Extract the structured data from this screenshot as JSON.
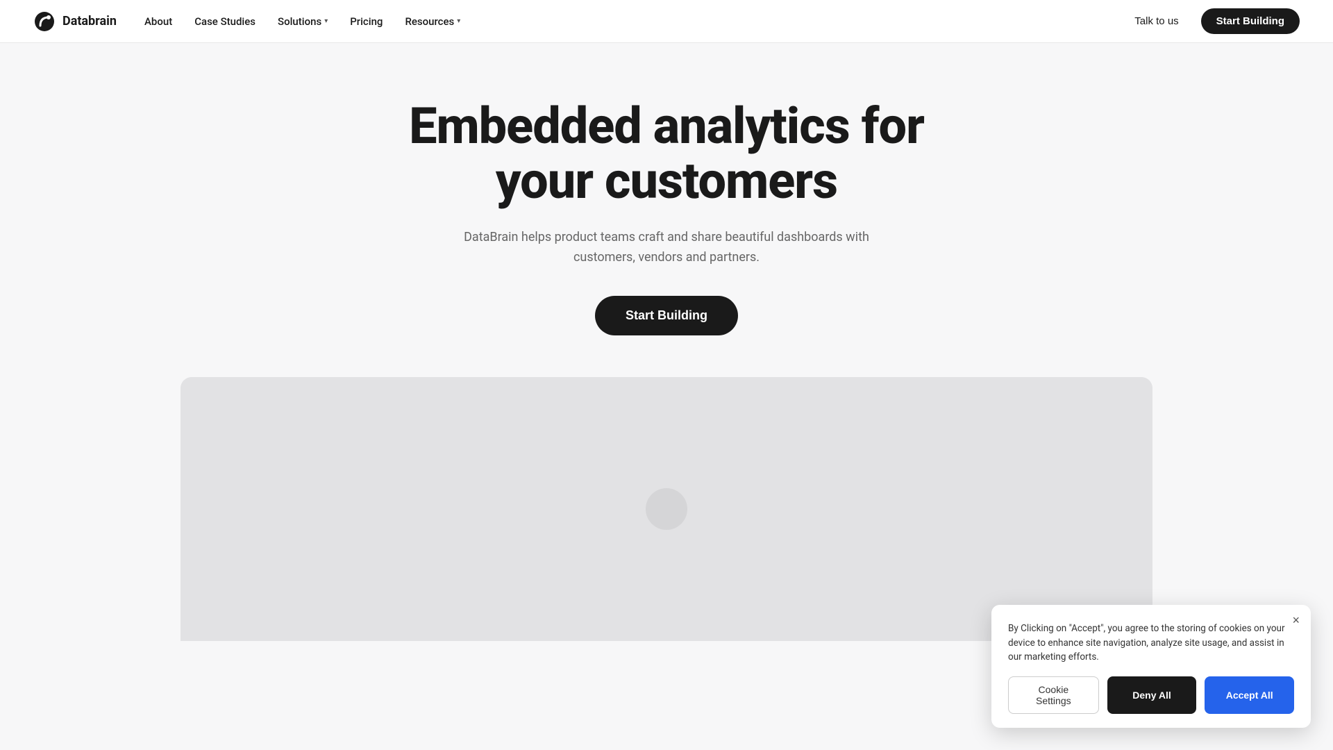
{
  "brand": {
    "name": "Databrain",
    "logo_icon": "databrain-logo-icon"
  },
  "nav": {
    "links": [
      {
        "label": "About",
        "has_dropdown": false
      },
      {
        "label": "Case Studies",
        "has_dropdown": false
      },
      {
        "label": "Solutions",
        "has_dropdown": true
      },
      {
        "label": "Pricing",
        "has_dropdown": false
      },
      {
        "label": "Resources",
        "has_dropdown": true
      }
    ],
    "talk_label": "Talk to us",
    "start_building_label": "Start Building"
  },
  "hero": {
    "title_line1": "Embedded analytics for",
    "title_line2": "your customers",
    "subtitle": "DataBrain helps product teams craft and share beautiful dashboards with customers, vendors and partners.",
    "cta_label": "Start Building"
  },
  "cookie": {
    "text": "By Clicking on \"Accept\", you agree to the storing of cookies on your device to enhance site navigation, analyze site usage, and assist in our marketing efforts.",
    "settings_label": "Cookie Settings",
    "deny_label": "Deny All",
    "accept_label": "Accept All",
    "close_icon": "×"
  }
}
